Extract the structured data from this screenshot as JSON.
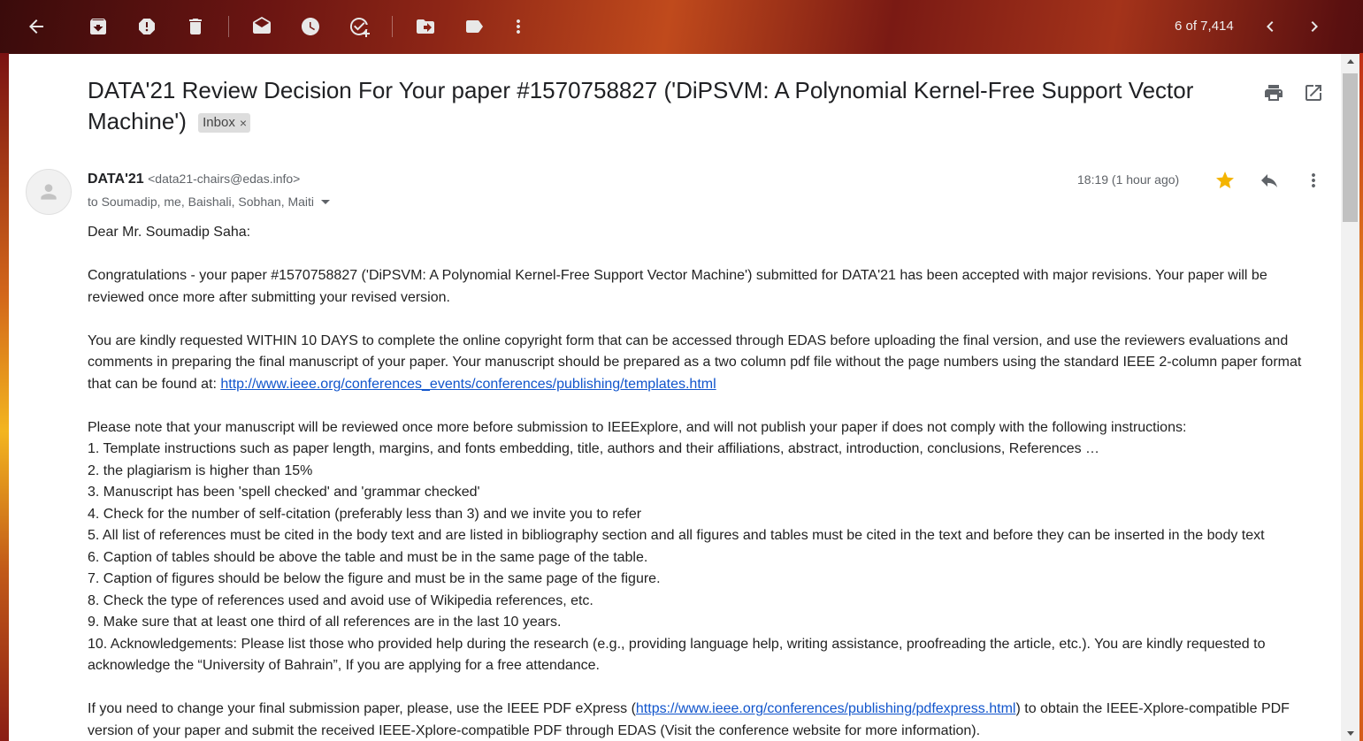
{
  "toolbar": {
    "pager": "6 of 7,414",
    "icons": [
      "back-arrow-icon",
      "archive-icon",
      "report-spam-icon",
      "delete-icon",
      "mark-unread-icon",
      "snooze-icon",
      "add-task-icon",
      "move-to-icon",
      "label-icon",
      "more-vert-icon",
      "chevron-left-icon",
      "chevron-right-icon"
    ]
  },
  "email": {
    "subject": "DATA'21 Review Decision For Your paper #1570758827 ('DiPSVM: A Polynomial Kernel-Free Support Vector Machine')",
    "label_chip": "Inbox",
    "label_chip_close": "×",
    "sender_name": "DATA'21",
    "sender_email": "<data21-chairs@edas.info>",
    "recipients": "to Soumadip, me, Baishali, Sobhan, Maiti",
    "time": "18:19 (1 hour ago)",
    "starred": true,
    "star_color": "#f4b400",
    "link_color": "#1155cc"
  },
  "body": {
    "greeting": "Dear Mr. Soumadip Saha:",
    "para1": "Congratulations - your paper #1570758827 ('DiPSVM: A Polynomial Kernel-Free Support Vector Machine') submitted for DATA'21 has been accepted with major revisions. Your paper will be reviewed once more after submitting your revised version.",
    "para2_text": "You are kindly requested WITHIN 10 DAYS to complete the online copyright form that can be accessed through EDAS before uploading the final version, and use the reviewers evaluations and comments in preparing the final manuscript of your paper. Your manuscript should be prepared as a two column pdf file without the page numbers using the standard IEEE 2-column paper format that can be found at: ",
    "para2_link": "http://www.ieee.org/conferences_events/conferences/publishing/templates.html",
    "para3_intro": "Please note that your manuscript will be reviewed once more before submission to IEEExplore, and will not publish your paper if does not comply with the following instructions:",
    "items": [
      "1. Template instructions such as paper length, margins, and fonts embedding, title, authors and their affiliations, abstract, introduction, conclusions, References …",
      "2. the plagiarism is higher than 15%",
      "3. Manuscript has been 'spell checked' and 'grammar checked'",
      "4. Check for the number of self-citation (preferably less than 3) and we invite you to refer",
      "5. All list of references must be cited in the body text and are listed in bibliography section and all figures and tables must be cited in the text and before they can be inserted in the body text",
      "6. Caption of tables should be above the table and must be in the same page of the table.",
      "7. Caption of figures should be below the figure and must be in the same page of the figure.",
      "8. Check the type of references used and avoid use of Wikipedia references, etc.",
      "9. Make sure that at least one third of all references are in the last 10 years.",
      "10. Acknowledgements: Please list those who provided help during the research (e.g., providing language help, writing assistance, proofreading the article, etc.). You are kindly requested to acknowledge the “University of Bahrain”, If you are applying for a free attendance."
    ],
    "para4_pre": "If you need to change your final submission paper, please, use the IEEE PDF eXpress (",
    "para4_link": "https://www.ieee.org/conferences/publishing/pdfexpress.html",
    "para4_post": ") to obtain the IEEE-Xplore-compatible PDF version of your paper and submit the received IEEE-Xplore-compatible PDF through EDAS (Visit the conference website for more information)."
  }
}
